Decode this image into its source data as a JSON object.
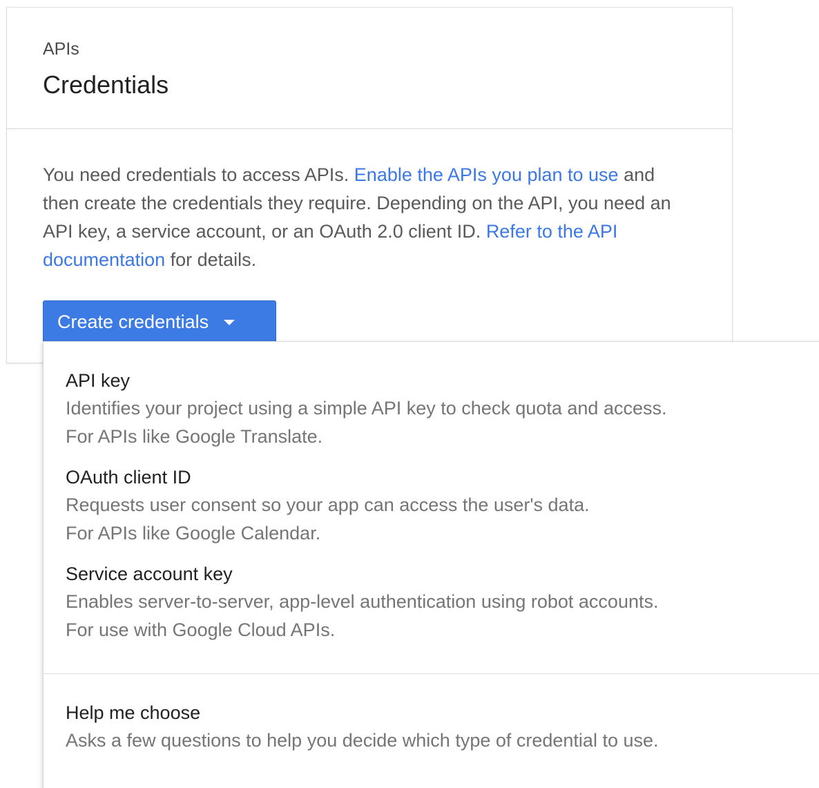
{
  "card": {
    "eyebrow": "APIs",
    "title": "Credentials",
    "intro": {
      "text_1": "You need credentials to access APIs. ",
      "link_1": "Enable the APIs you plan to use",
      "text_2": " and then create the credentials they require. Depending on the API, you need an API key, a service account, or an OAuth 2.0 client ID. ",
      "link_2": "Refer to the API documentation",
      "text_3": " for details."
    },
    "create_button_label": "Create credentials"
  },
  "menu": {
    "items": [
      {
        "label": "API key",
        "desc_1": "Identifies your project using a simple API key to check quota and access.",
        "desc_2": "For APIs like Google Translate."
      },
      {
        "label": "OAuth client ID",
        "desc_1": "Requests user consent so your app can access the user's data.",
        "desc_2": "For APIs like Google Calendar."
      },
      {
        "label": "Service account key",
        "desc_1": "Enables server-to-server, app-level authentication using robot accounts.",
        "desc_2": "For use with Google Cloud APIs."
      }
    ],
    "help": {
      "label": "Help me choose",
      "desc_1": "Asks a few questions to help you decide which type of credential to use."
    }
  },
  "colors": {
    "accent": "#3d7be4",
    "link": "#3b78e7"
  }
}
